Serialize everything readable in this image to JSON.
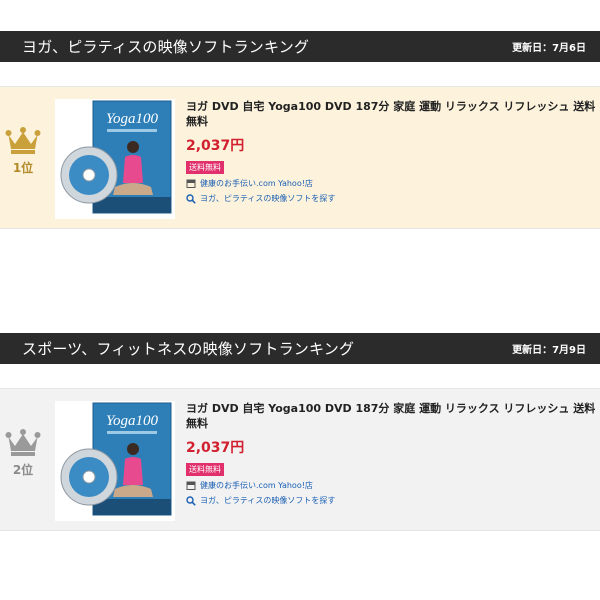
{
  "rankings": [
    {
      "title": "ヨガ、ピラティスの映像ソフトランキング",
      "updated": "更新日：7月6日",
      "item": {
        "rank_label": "1位",
        "medal": "gold-crown-icon",
        "name": "ヨガ DVD 自宅 Yoga100 DVD 187分 家庭 運動 リラックス リフレッシュ 送料無料",
        "price": "2,037円",
        "shipping": "送料無料",
        "store": "健康のお手伝い.com Yahoo!店",
        "search_link": "ヨガ、ピラティスの映像ソフトを探す",
        "cover_title": "Yoga100"
      }
    },
    {
      "title": "スポーツ、フィットネスの映像ソフトランキング",
      "updated": "更新日：7月9日",
      "item": {
        "rank_label": "2位",
        "medal": "silver-crown-icon",
        "name": "ヨガ DVD 自宅 Yoga100 DVD 187分 家庭 運動 リラックス リフレッシュ 送料無料",
        "price": "2,037円",
        "shipping": "送料無料",
        "store": "健康のお手伝い.com Yahoo!店",
        "search_link": "ヨガ、ピラティスの映像ソフトを探す",
        "cover_title": "Yoga100"
      }
    }
  ],
  "colors": {
    "header_bg": "#2b2b2b",
    "gold_card_bg": "#fdf3dc",
    "silver_card_bg": "#f2f2f2",
    "price": "#d1202f",
    "badge": "#e1306c",
    "link": "#1a5fb4",
    "gold": "#c9a03a",
    "silver": "#9a9a9a"
  }
}
